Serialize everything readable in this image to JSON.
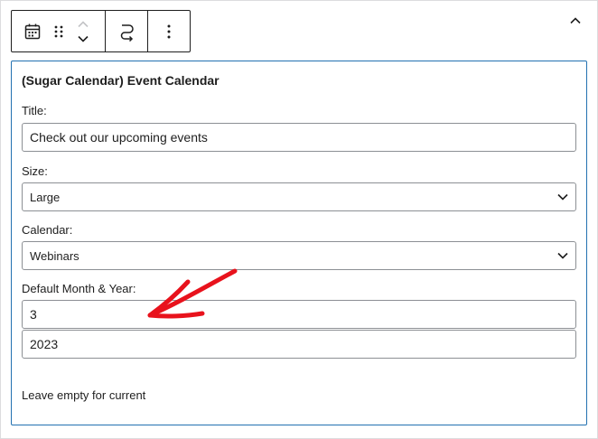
{
  "toolbar": {
    "buttons": [
      {
        "name": "block-type-calendar",
        "icon": "calendar-icon"
      },
      {
        "name": "drag-handle",
        "icon": "drag-handle-icon"
      },
      {
        "name": "move-up",
        "icon": "chevron-up-icon"
      },
      {
        "name": "move-down",
        "icon": "chevron-down-icon"
      },
      {
        "name": "transform",
        "icon": "transform-icon"
      },
      {
        "name": "options",
        "icon": "more-vertical-icon"
      }
    ],
    "collapse_icon": "chevron-up-icon"
  },
  "block": {
    "title": "(Sugar Calendar) Event Calendar",
    "fields": {
      "title": {
        "label": "Title:",
        "value": "Check out our upcoming events"
      },
      "size": {
        "label": "Size:",
        "value": "Large"
      },
      "calendar": {
        "label": "Calendar:",
        "value": "Webinars"
      },
      "default_month_year": {
        "label": "Default Month & Year:",
        "month": "3",
        "year": "2023"
      }
    },
    "help_text": "Leave empty for current"
  },
  "colors": {
    "accent_border": "#2271b1",
    "annotation_arrow": "#e8121c",
    "input_border": "#8c8f94",
    "text": "#1e1e1e"
  }
}
